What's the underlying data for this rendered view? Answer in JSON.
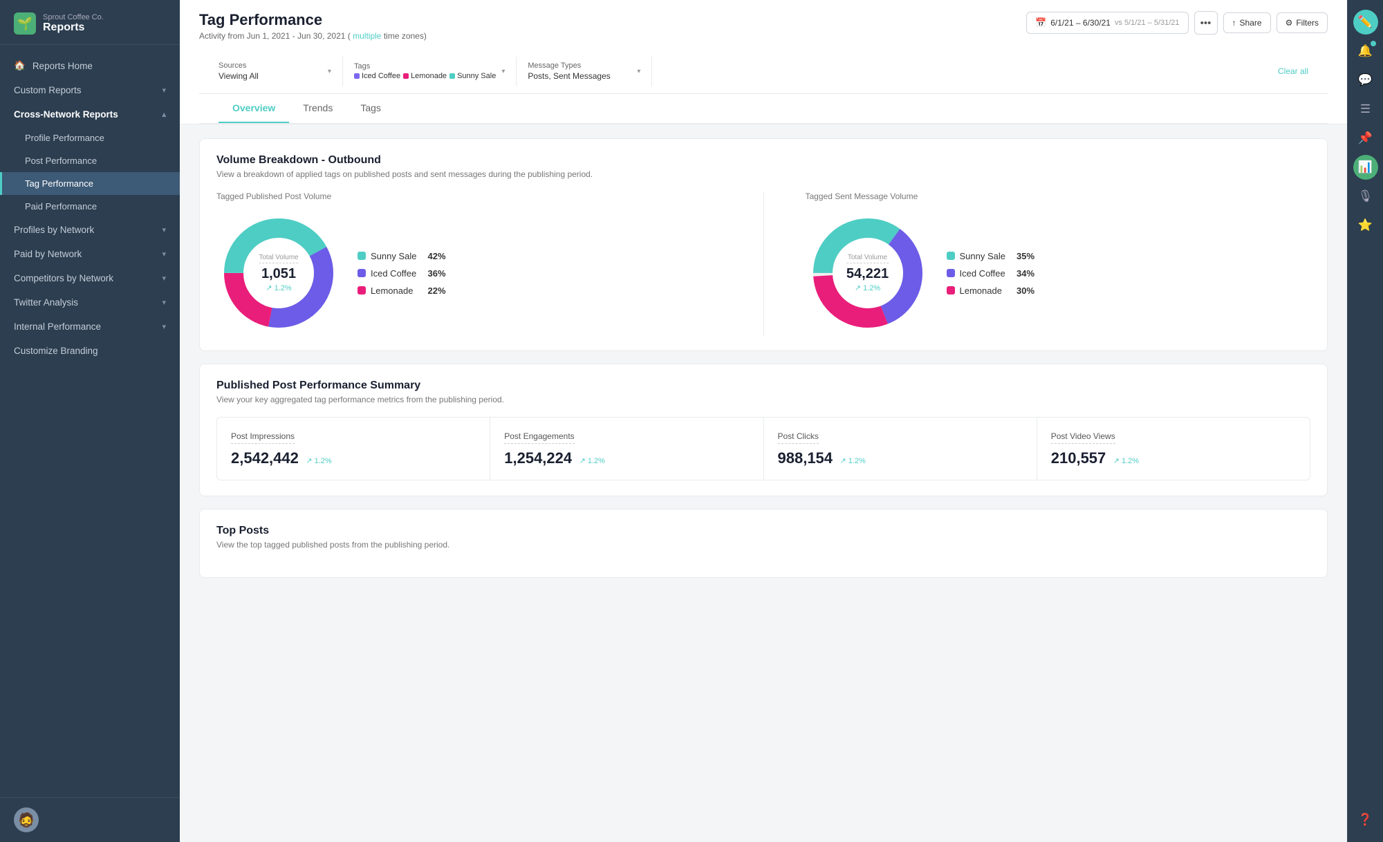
{
  "brand": {
    "company": "Sprout Coffee Co.",
    "app": "Reports"
  },
  "sidebar": {
    "top_items": [
      {
        "id": "reports-home",
        "label": "Reports Home",
        "icon": "🏠"
      }
    ],
    "custom_reports": {
      "label": "Custom Reports",
      "chevron": "▾"
    },
    "cross_network": {
      "label": "Cross-Network Reports",
      "chevron": "▴",
      "expanded": true,
      "children": [
        {
          "id": "profile-performance",
          "label": "Profile Performance",
          "active": false
        },
        {
          "id": "post-performance",
          "label": "Post Performance",
          "active": false
        },
        {
          "id": "tag-performance",
          "label": "Tag Performance",
          "active": true
        },
        {
          "id": "paid-performance",
          "label": "Paid Performance",
          "active": false
        }
      ]
    },
    "sections": [
      {
        "id": "profiles-by-network",
        "label": "Profiles by Network",
        "chevron": "▾"
      },
      {
        "id": "paid-by-network",
        "label": "Paid by Network",
        "chevron": "▾"
      },
      {
        "id": "competitors-by-network",
        "label": "Competitors by Network",
        "chevron": "▾"
      },
      {
        "id": "twitter-analysis",
        "label": "Twitter Analysis",
        "chevron": "▾"
      },
      {
        "id": "internal-performance",
        "label": "Internal Performance",
        "chevron": "▾"
      }
    ],
    "customize_branding": "Customize Branding"
  },
  "page": {
    "title": "Tag Performance",
    "subtitle": "Activity from Jun 1, 2021 - Jun 30, 2021",
    "subtitle_link": "multiple",
    "subtitle_suffix": " time zones)"
  },
  "header_actions": {
    "date_range": "6/1/21 – 6/30/21",
    "vs_date": "vs 5/1/21 – 5/31/21",
    "more_label": "•••",
    "share_label": "Share",
    "filters_label": "Filters"
  },
  "filters": {
    "sources": {
      "label": "Sources",
      "value": "Viewing All"
    },
    "tags": {
      "label": "Tags",
      "items": [
        {
          "name": "Iced Coffee",
          "color": "#7b68ee"
        },
        {
          "name": "Lemonade",
          "color": "#e91e7a"
        },
        {
          "name": "Sunny Sale",
          "color": "#4ecdc4"
        }
      ]
    },
    "message_types": {
      "label": "Message Types",
      "value": "Posts, Sent Messages"
    },
    "clear_all": "Clear all"
  },
  "tabs": [
    {
      "id": "overview",
      "label": "Overview",
      "active": true
    },
    {
      "id": "trends",
      "label": "Trends",
      "active": false
    },
    {
      "id": "tags",
      "label": "Tags",
      "active": false
    }
  ],
  "volume_breakdown": {
    "title": "Volume Breakdown - Outbound",
    "subtitle": "View a breakdown of applied tags on published posts and sent messages during the publishing period.",
    "left_chart": {
      "label": "Tagged Published Post Volume",
      "center_label": "Total Volume",
      "center_value": "1,051",
      "trend": "↗ 1.2%",
      "legend": [
        {
          "name": "Sunny Sale",
          "pct": "42%",
          "color": "#4ecdc4"
        },
        {
          "name": "Iced Coffee",
          "pct": "36%",
          "color": "#6c5ce7"
        },
        {
          "name": "Lemonade",
          "pct": "22%",
          "color": "#e91e7a"
        }
      ],
      "segments": [
        {
          "pct": 42,
          "color": "#4ecdc4"
        },
        {
          "pct": 36,
          "color": "#6c5ce7"
        },
        {
          "pct": 22,
          "color": "#e91e7a"
        }
      ]
    },
    "right_chart": {
      "label": "Tagged Sent Message Volume",
      "center_label": "Total Volume",
      "center_value": "54,221",
      "trend": "↗ 1.2%",
      "legend": [
        {
          "name": "Sunny Sale",
          "pct": "35%",
          "color": "#4ecdc4"
        },
        {
          "name": "Iced Coffee",
          "pct": "34%",
          "color": "#6c5ce7"
        },
        {
          "name": "Lemonade",
          "pct": "30%",
          "color": "#e91e7a"
        }
      ],
      "segments": [
        {
          "pct": 35,
          "color": "#4ecdc4"
        },
        {
          "pct": 34,
          "color": "#6c5ce7"
        },
        {
          "pct": 30,
          "color": "#e91e7a"
        }
      ]
    }
  },
  "post_performance": {
    "title": "Published Post Performance Summary",
    "subtitle": "View your key aggregated tag performance metrics from the publishing period.",
    "stats": [
      {
        "id": "post-impressions",
        "label": "Post Impressions",
        "value": "2,542,442",
        "trend": "↗ 1.2%"
      },
      {
        "id": "post-engagements",
        "label": "Post Engagements",
        "value": "1,254,224",
        "trend": "↗ 1.2%"
      },
      {
        "id": "post-clicks",
        "label": "Post Clicks",
        "value": "988,154",
        "trend": "↗ 1.2%"
      },
      {
        "id": "post-video-views",
        "label": "Post Video Views",
        "value": "210,557",
        "trend": "↗ 1.2%"
      }
    ]
  },
  "top_posts": {
    "title": "Top Posts",
    "subtitle": "View the top tagged published posts from the publishing period."
  },
  "icon_bar": [
    {
      "id": "compose-icon",
      "icon": "✏️",
      "active": true,
      "badge": false
    },
    {
      "id": "notifications-icon",
      "icon": "🔔",
      "active": false,
      "badge": true
    },
    {
      "id": "messages-icon",
      "icon": "💬",
      "active": false,
      "badge": false
    },
    {
      "id": "tasks-icon",
      "icon": "☰",
      "active": false,
      "badge": false
    },
    {
      "id": "publish-icon",
      "icon": "📅",
      "active": false,
      "badge": false
    },
    {
      "id": "analytics-icon",
      "icon": "📊",
      "active": true,
      "badge": false
    },
    {
      "id": "listen-icon",
      "icon": "🎙️",
      "active": false,
      "badge": false
    },
    {
      "id": "reviews-icon",
      "icon": "⭐",
      "active": false,
      "badge": false
    },
    {
      "id": "help-icon",
      "icon": "❓",
      "active": false,
      "badge": false
    }
  ]
}
